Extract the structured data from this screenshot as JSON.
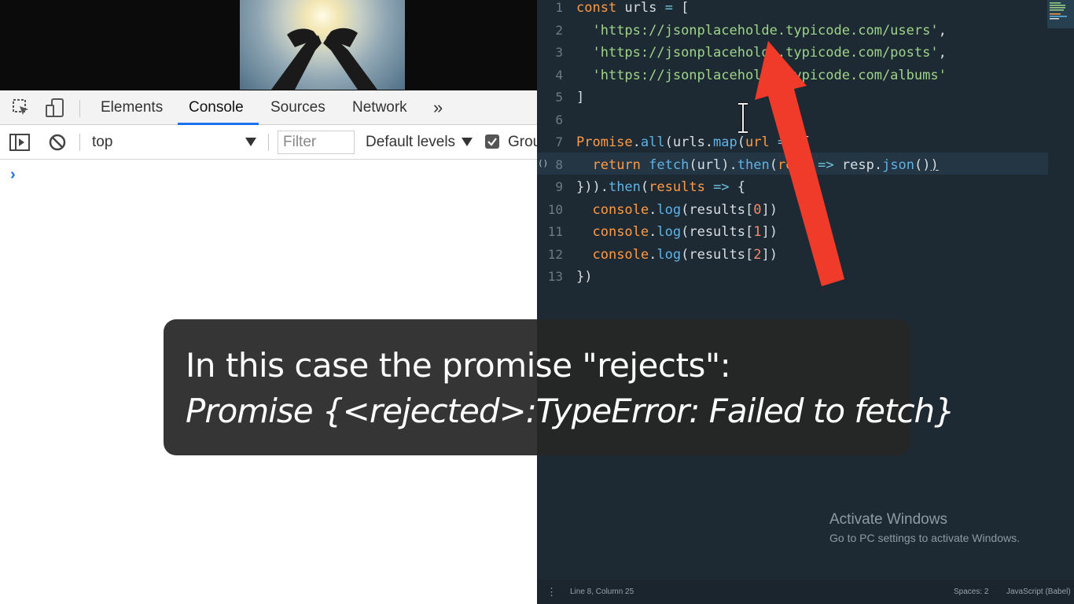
{
  "devtools": {
    "tabs": [
      "Elements",
      "Console",
      "Sources",
      "Network"
    ],
    "active_tab": "Console",
    "more_tabs_glyph": "»",
    "context_value": "top",
    "filter_placeholder": "Filter",
    "levels_label": "Default levels",
    "group_label": "Grou",
    "prompt_glyph": "›"
  },
  "editor": {
    "lines": [
      {
        "n": "1",
        "tokens": [
          [
            "k",
            "const"
          ],
          [
            "p",
            " urls "
          ],
          [
            "o",
            "="
          ],
          [
            "p",
            " ["
          ]
        ]
      },
      {
        "n": "2",
        "tokens": [
          [
            "p",
            "  "
          ],
          [
            "s",
            "'https://jsonplaceholde.typicode.com/users'"
          ],
          [
            "p",
            ","
          ]
        ]
      },
      {
        "n": "3",
        "tokens": [
          [
            "p",
            "  "
          ],
          [
            "s",
            "'https://jsonplaceholde.typicode.com/posts'"
          ],
          [
            "p",
            ","
          ]
        ]
      },
      {
        "n": "4",
        "tokens": [
          [
            "p",
            "  "
          ],
          [
            "s",
            "'https://jsonplaceholde.typicode.com/albums'"
          ]
        ]
      },
      {
        "n": "5",
        "tokens": [
          [
            "p",
            "]"
          ]
        ]
      },
      {
        "n": "6",
        "tokens": []
      },
      {
        "n": "7",
        "tokens": [
          [
            "k",
            "Promise"
          ],
          [
            "p",
            "."
          ],
          [
            "f",
            "all"
          ],
          [
            "p",
            "(urls."
          ],
          [
            "f",
            "map"
          ],
          [
            "p",
            "("
          ],
          [
            "k",
            "url"
          ],
          [
            "p",
            " "
          ],
          [
            "o",
            "=>"
          ],
          [
            "p",
            " {"
          ]
        ]
      },
      {
        "n": "8",
        "tokens": [
          [
            "p",
            "  "
          ],
          [
            "k",
            "return"
          ],
          [
            "p",
            " "
          ],
          [
            "f",
            "fetch"
          ],
          [
            "p",
            "(url)."
          ],
          [
            "f",
            "then"
          ],
          [
            "p",
            "("
          ],
          [
            "k",
            "resp"
          ],
          [
            "p",
            " "
          ],
          [
            "o",
            "=>"
          ],
          [
            "p",
            " resp."
          ],
          [
            "f",
            "json"
          ],
          [
            "p",
            "()"
          ],
          [
            "u",
            ")"
          ]
        ]
      },
      {
        "n": "9",
        "tokens": [
          [
            "p",
            "}))."
          ],
          [
            "f",
            "then"
          ],
          [
            "p",
            "("
          ],
          [
            "k",
            "results"
          ],
          [
            "p",
            " "
          ],
          [
            "o",
            "=>"
          ],
          [
            "p",
            " {"
          ]
        ]
      },
      {
        "n": "10",
        "tokens": [
          [
            "p",
            "  "
          ],
          [
            "k",
            "console"
          ],
          [
            "p",
            "."
          ],
          [
            "f",
            "log"
          ],
          [
            "p",
            "(results["
          ],
          [
            "n",
            "0"
          ],
          [
            "p",
            "])"
          ]
        ]
      },
      {
        "n": "11",
        "tokens": [
          [
            "p",
            "  "
          ],
          [
            "k",
            "console"
          ],
          [
            "p",
            "."
          ],
          [
            "f",
            "log"
          ],
          [
            "p",
            "(results["
          ],
          [
            "n",
            "1"
          ],
          [
            "p",
            "])"
          ]
        ]
      },
      {
        "n": "12",
        "tokens": [
          [
            "p",
            "  "
          ],
          [
            "k",
            "console"
          ],
          [
            "p",
            "."
          ],
          [
            "f",
            "log"
          ],
          [
            "p",
            "(results["
          ],
          [
            "n",
            "2"
          ],
          [
            "p",
            "])"
          ]
        ]
      },
      {
        "n": "13",
        "tokens": [
          [
            "p",
            "})"
          ]
        ]
      }
    ],
    "fold_marker": "()",
    "status_position": "Line 8, Column 25",
    "status_spaces": "Spaces: 2",
    "status_language": "JavaScript (Babel)",
    "status_dots": "⋮"
  },
  "watermark": {
    "title": "Activate Windows",
    "subtitle": "Go to PC settings to activate Windows."
  },
  "caption": {
    "line1": "In this case the promise \"rejects\":",
    "line2": "Promise {<rejected>:TypeError: Failed to fetch}"
  },
  "colors": {
    "arrow": "#f03a2a",
    "accent": "#1a73e8",
    "editor_bg": "#1e2a33"
  },
  "icons": [
    "inspect-icon",
    "device-toggle-icon",
    "sidebar-toggle-icon",
    "clear-console-icon",
    "dropdown-arrow-icon",
    "text-cursor-icon",
    "red-arrow"
  ]
}
